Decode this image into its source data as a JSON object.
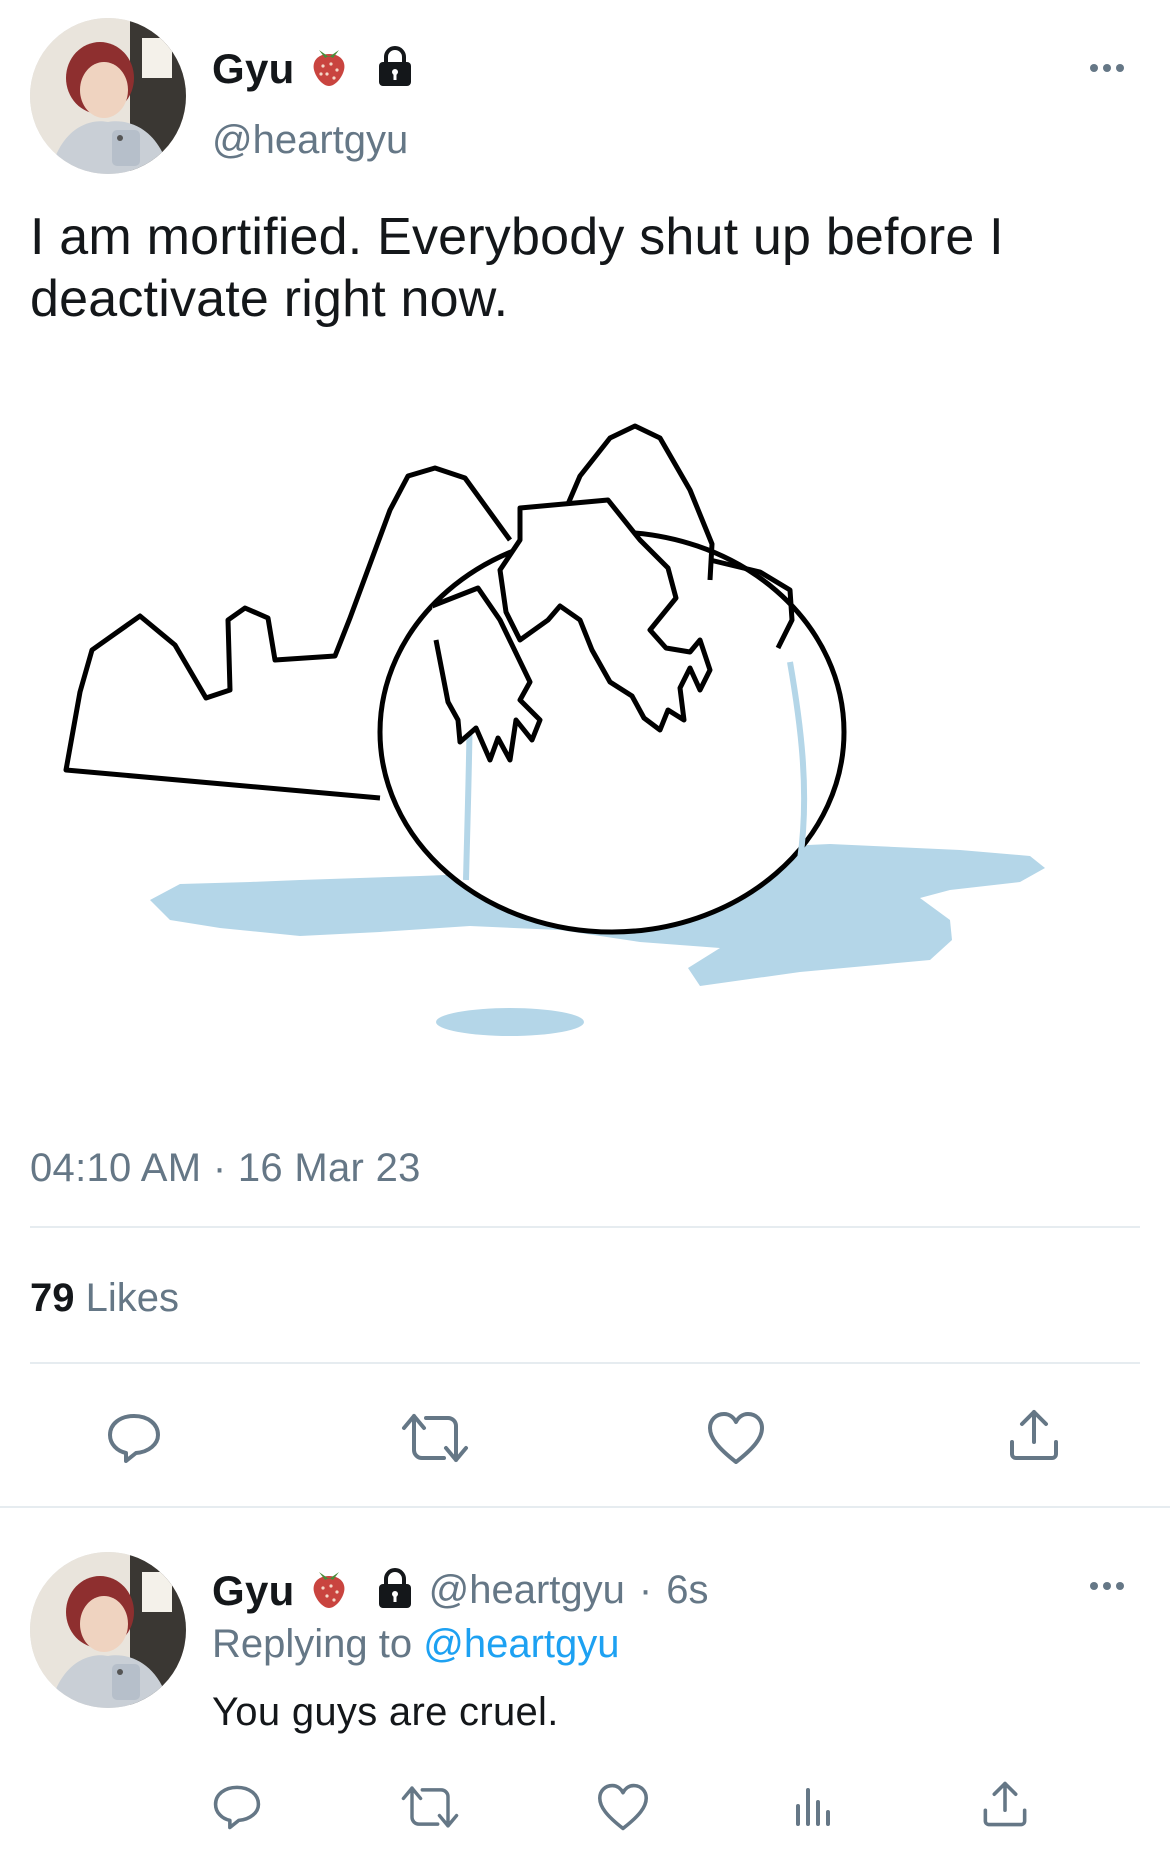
{
  "tweet": {
    "author_name": "Gyu",
    "author_handle": "@heartgyu",
    "text": "I am mortified. Everybody shut up before I deactivate right now.",
    "time": "04:10 AM",
    "separator": "·",
    "date": "16 Mar 23",
    "likes_count": "79",
    "likes_label": "Likes"
  },
  "reply": {
    "author_name": "Gyu",
    "author_handle": "@heartgyu",
    "separator": "·",
    "age": "6s",
    "replying_prefix": "Replying to",
    "replying_to": "@heartgyu",
    "text": "You guys are cruel."
  },
  "icons": {
    "badge": "strawberry-icon",
    "protected": "lock-icon",
    "actions": [
      "reply-icon",
      "retweet-icon",
      "like-icon",
      "share-icon"
    ],
    "reply_actions": [
      "reply-icon",
      "retweet-icon",
      "like-icon",
      "analytics-icon",
      "share-icon"
    ]
  },
  "colors": {
    "text": "#14171a",
    "secondary": "#657786",
    "link": "#1da1f2",
    "puddle": "#b4d6e8"
  }
}
